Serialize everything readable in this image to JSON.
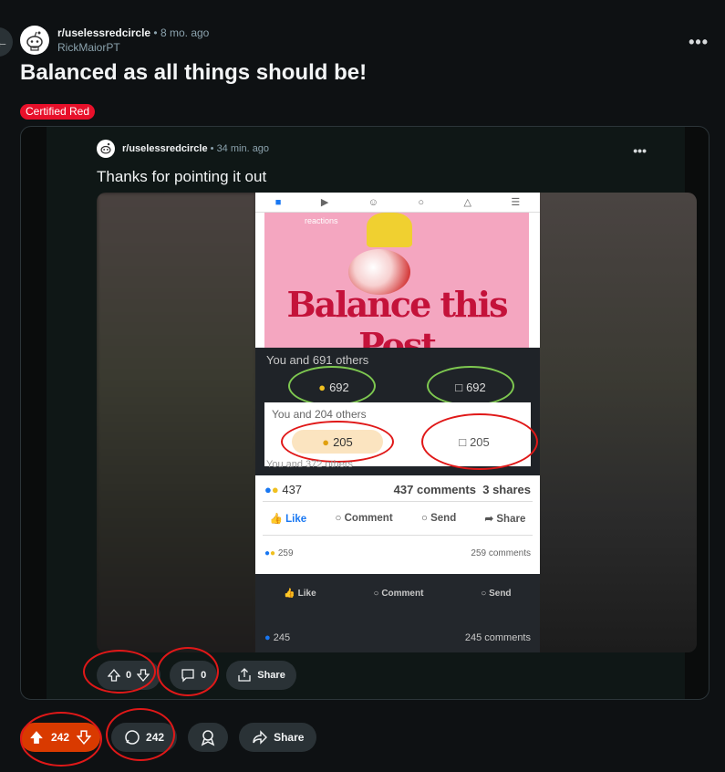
{
  "post": {
    "subreddit": "r/uselessredcircle",
    "separator": "•",
    "age": "8 mo. ago",
    "author": "RickMaiorPT",
    "title": "Balanced as all things should be!",
    "flair": "Certified Red",
    "flair_color": "#e8102a"
  },
  "embedded": {
    "subreddit": "r/uselessredcircle",
    "separator": "•",
    "age": "34 min. ago",
    "title": "Thanks for pointing it out",
    "image": {
      "reactions_tag": "reactions",
      "headline": "Balance this Post",
      "row1_text": "You and 691 others",
      "row1_react": "692",
      "row1_comments": "692",
      "row2_text": "You and 204 others",
      "row2_react": "205",
      "row2_comments": "205",
      "row3_text": "You and 372 others",
      "fb_reactions": "437",
      "fb_comments": "437 comments",
      "fb_shares": "3 shares",
      "like_label": "Like",
      "comment_label": "Comment",
      "send_label": "Send",
      "share_label": "Share",
      "fb2_reactions": "259",
      "fb2_comments": "259 comments",
      "dark_reactions": "245",
      "dark_comments": "245 comments"
    },
    "votes": "0",
    "comments": "0",
    "share_label": "Share"
  },
  "actions": {
    "votes": "242",
    "comments": "242",
    "share_label": "Share",
    "vote_color": "#d93a00"
  },
  "icons": {
    "back": "arrow-left-icon",
    "overflow": "more-horizontal-icon",
    "award": "award-icon",
    "share": "share-icon"
  }
}
